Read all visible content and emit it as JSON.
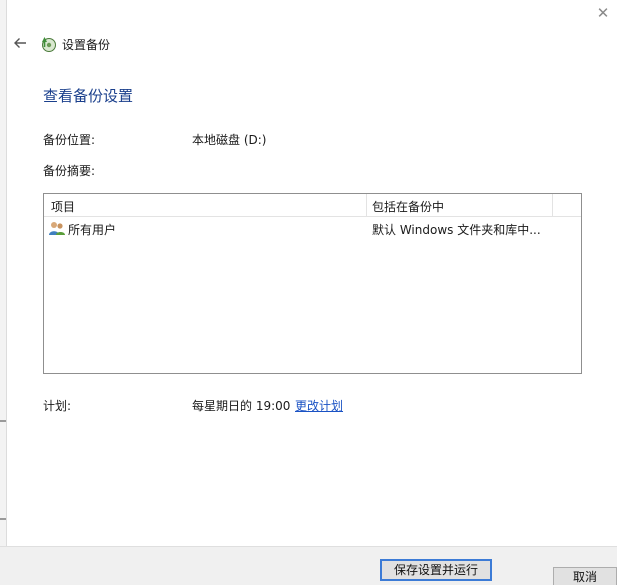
{
  "window": {
    "close_glyph": "✕"
  },
  "header": {
    "back_icon": "back-arrow-icon",
    "app_icon": "backup-icon",
    "app_title": "设置备份"
  },
  "main": {
    "page_title": "查看备份设置",
    "backup_location_label": "备份位置:",
    "backup_location_value": "本地磁盘 (D:)",
    "backup_summary_label": "备份摘要:",
    "summary_table": {
      "columns": [
        "项目",
        "包括在备份中"
      ],
      "rows": [
        {
          "icon": "users-icon",
          "item": "所有用户",
          "included": "默认 Windows 文件夹和库中..."
        }
      ]
    },
    "schedule_label": "计划:",
    "schedule_value": "每星期日的 19:00",
    "change_schedule_link": "更改计划"
  },
  "footer": {
    "save_run_button": "保存设置并运行",
    "cancel_button": "取消"
  }
}
